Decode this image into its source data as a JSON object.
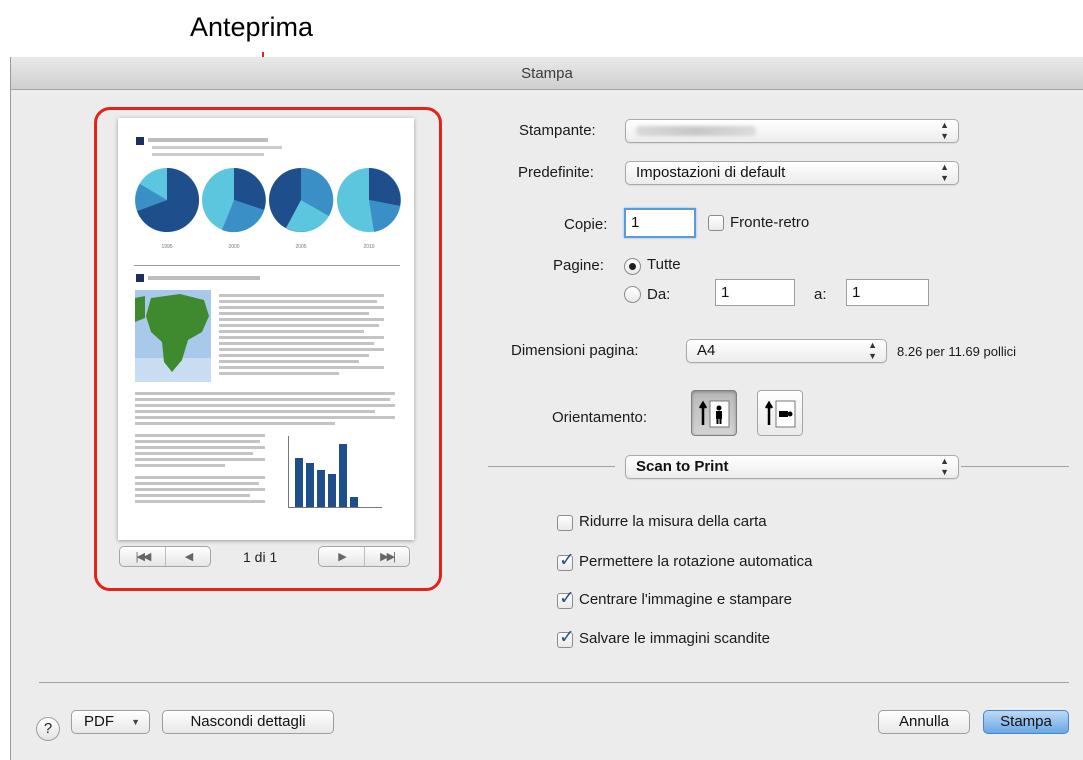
{
  "callout": {
    "label": "Anteprima"
  },
  "window": {
    "title": "Stampa"
  },
  "preview": {
    "page_indicator": "1 di 1",
    "chart_years": [
      "1995",
      "2000",
      "2005",
      "2010"
    ],
    "nav": {
      "first_icon": "first-page-icon",
      "prev_icon": "previous-page-icon",
      "next_icon": "next-page-icon",
      "last_icon": "last-page-icon"
    }
  },
  "form": {
    "printer_label": "Stampante:",
    "printer_value": "",
    "presets_label": "Predefinite:",
    "presets_value": "Impostazioni di default",
    "copies_label": "Copie:",
    "copies_value": "1",
    "duplex_label": "Fronte-retro",
    "duplex_checked": false,
    "pages_label": "Pagine:",
    "pages_all_label": "Tutte",
    "pages_from_label": "Da:",
    "pages_from_value": "1",
    "pages_to_label": "a:",
    "pages_to_value": "1",
    "paper_label": "Dimensioni pagina:",
    "paper_value": "A4",
    "paper_dims": "8.26 per 11.69 pollici",
    "orientation_label": "Orientamento:",
    "section_value": "Scan to Print"
  },
  "options": [
    {
      "label": "Ridurre la misura della carta",
      "checked": false
    },
    {
      "label": "Permettere la rotazione automatica",
      "checked": true
    },
    {
      "label": "Centrare l'immagine e stampare",
      "checked": true
    },
    {
      "label": "Salvare le immagini scandite",
      "checked": true
    }
  ],
  "footer": {
    "help": "?",
    "pdf": "PDF",
    "hide_details": "Nascondi dettagli",
    "cancel": "Annulla",
    "print": "Stampa"
  },
  "colors": {
    "accent": "#e2231a",
    "default_button": "#6aa7e6",
    "chart_dark": "#1f4e8c",
    "chart_mid": "#3a8fc7",
    "chart_light": "#5cc6df",
    "map_green": "#3f8a2e"
  }
}
